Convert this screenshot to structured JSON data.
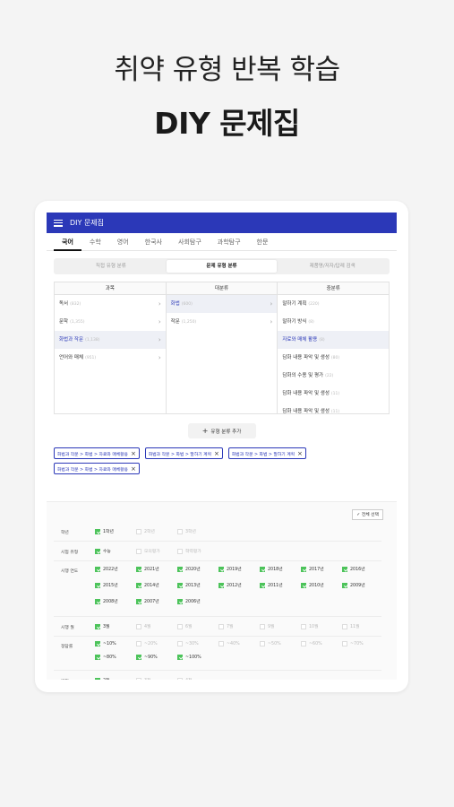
{
  "hero": {
    "line1": "취약 유형 반복 학습",
    "line2": "DIY 문제집"
  },
  "app": {
    "title": "DIY 문제집"
  },
  "subject_tabs": [
    "국어",
    "수학",
    "영어",
    "한국사",
    "사회탐구",
    "과학탐구",
    "한문"
  ],
  "segments": [
    "직접 유형 분류",
    "문제 유형 분류",
    "제품명/저자/답례 검색"
  ],
  "columns": {
    "headers": [
      "과목",
      "대분류",
      "중분류"
    ],
    "col1": [
      {
        "label": "독서",
        "count": "(832)"
      },
      {
        "label": "문학",
        "count": "(1,355)"
      },
      {
        "label": "화법과 작문",
        "count": "(1,138)"
      },
      {
        "label": "언어와 매체",
        "count": "(951)"
      }
    ],
    "col2": [
      {
        "label": "화법",
        "count": "(600)"
      },
      {
        "label": "작문",
        "count": "(1,250)"
      }
    ],
    "col3": [
      {
        "label": "말하기 계획",
        "count": "(220)"
      },
      {
        "label": "말하기 방식",
        "count": "(8)"
      },
      {
        "label": "자료와 매체 활용",
        "count": "(8)"
      },
      {
        "label": "담화 내용 파악 및 생성",
        "count": "(80)"
      },
      {
        "label": "담화의 수용 및 평가",
        "count": "(22)"
      },
      {
        "label": "담화 내용 파악 및 생성",
        "count": "(11)"
      },
      {
        "label": "담화 내용 파악 및 생성",
        "count": "(11)"
      }
    ]
  },
  "add_button": "유형 분류 추가",
  "chips": [
    "화법과 작문 > 화법 > 자료와 매체활용",
    "화법과 작문 > 화법 > 말하기 계획",
    "화법과 작문 > 화법 > 말하기 계획",
    "화법과 작문 > 화법 > 자료와 매체활용"
  ],
  "select_all": "전체 선택",
  "filters": {
    "grade": {
      "label": "학년",
      "options": [
        {
          "t": "1학년",
          "on": true
        },
        {
          "t": "2학년",
          "on": false
        },
        {
          "t": "3학년",
          "on": false
        }
      ]
    },
    "exam_type": {
      "label": "시험 유형",
      "options": [
        {
          "t": "수능",
          "on": true
        },
        {
          "t": "모의평가",
          "on": false
        },
        {
          "t": "학력평가",
          "on": false
        }
      ]
    },
    "year": {
      "label": "시행 연도",
      "options": [
        {
          "t": "2022년",
          "on": true
        },
        {
          "t": "2021년",
          "on": true
        },
        {
          "t": "2020년",
          "on": true
        },
        {
          "t": "2019년",
          "on": true
        },
        {
          "t": "2018년",
          "on": true
        },
        {
          "t": "2017년",
          "on": true
        },
        {
          "t": "2016년",
          "on": true
        },
        {
          "t": "2015년",
          "on": true
        },
        {
          "t": "2014년",
          "on": true
        },
        {
          "t": "2013년",
          "on": true
        },
        {
          "t": "2012년",
          "on": true
        },
        {
          "t": "2011년",
          "on": true
        },
        {
          "t": "2010년",
          "on": true
        },
        {
          "t": "2009년",
          "on": true
        },
        {
          "t": "2008년",
          "on": true
        },
        {
          "t": "2007년",
          "on": true
        },
        {
          "t": "2006년",
          "on": true
        }
      ]
    },
    "month": {
      "label": "시행 월",
      "options": [
        {
          "t": "3월",
          "on": true
        },
        {
          "t": "4월",
          "on": false
        },
        {
          "t": "6월",
          "on": false
        },
        {
          "t": "7월",
          "on": false
        },
        {
          "t": "9월",
          "on": false
        },
        {
          "t": "10월",
          "on": false
        },
        {
          "t": "11월",
          "on": false
        }
      ]
    },
    "rate": {
      "label": "정답률",
      "options": [
        {
          "t": "~10%",
          "on": true
        },
        {
          "t": "~20%",
          "on": false
        },
        {
          "t": "~30%",
          "on": false
        },
        {
          "t": "~40%",
          "on": false
        },
        {
          "t": "~50%",
          "on": false
        },
        {
          "t": "~60%",
          "on": false
        },
        {
          "t": "~70%",
          "on": false
        },
        {
          "t": "~80%",
          "on": true
        },
        {
          "t": "~90%",
          "on": true
        },
        {
          "t": "~100%",
          "on": true
        }
      ]
    },
    "score": {
      "label": "배점",
      "options": [
        {
          "t": "2점",
          "on": true
        },
        {
          "t": "3점",
          "on": false
        },
        {
          "t": "4점",
          "on": false
        }
      ]
    }
  },
  "colors": {
    "appbar": "#2b38b8",
    "check": "#4cc35a",
    "accent": "#2b38b8"
  }
}
